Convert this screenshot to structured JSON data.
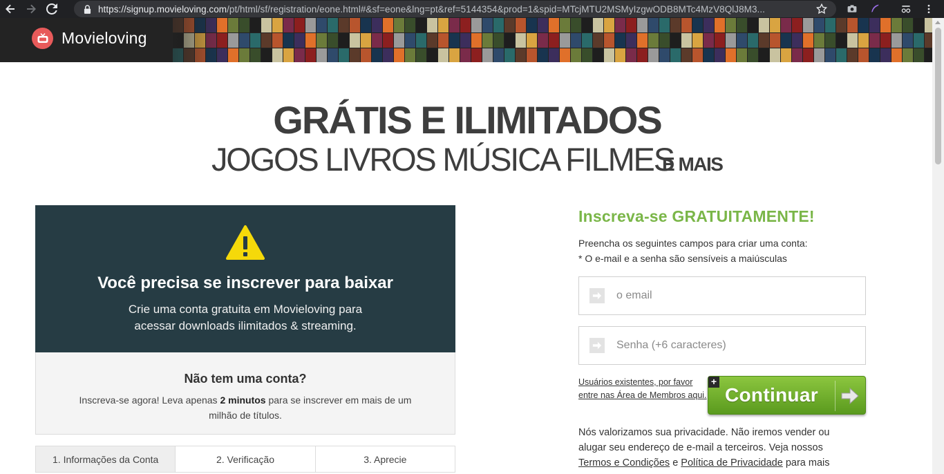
{
  "browser": {
    "url_host": "https://signup.movieloving.com",
    "url_rest": "/pt/html/sf/registration/eone.html#&sf=eone&lng=pt&ref=5144354&prod=1&spid=MTcjMTU2MSMyIzgwODB8MTc4MzV8QlJ8M3...",
    "icons": [
      "back-arrow",
      "forward-arrow",
      "reload",
      "lock",
      "star",
      "camera",
      "feather",
      "extensions",
      "menu"
    ]
  },
  "header": {
    "brand": "Movieloving",
    "poster_colors": [
      "#5b3a2a",
      "#2f4a6b",
      "#8c1f1f",
      "#d9a441",
      "#1e1e1e",
      "#6b7b3a",
      "#3c2e5c",
      "#b8552d",
      "#2a6a6a",
      "#9a9a9a",
      "#7a2b4a",
      "#c9c3a0",
      "#394d2b",
      "#e0702a",
      "#18344f"
    ]
  },
  "hero": {
    "title": "GRÁTIS E ILIMITADOS",
    "subtitle": "JOGOS LIVROS MÚSICA FILMES",
    "extra": "E MAIS"
  },
  "notice": {
    "heading": "Você precisa se inscrever para baixar",
    "text_line1": "Crie uma conta gratuita em Movieloving para",
    "text_line2": "acessar downloads ilimitados & streaming.",
    "icon": "warning-icon",
    "bg_color": "#263c44",
    "icon_color": "#f5d90a"
  },
  "no_account": {
    "heading": "Não tem uma conta?",
    "text_before": "Inscreva-se agora! Leva apenas ",
    "text_bold": "2 minutos",
    "text_after": " para se inscrever em mais de um milhão de títulos."
  },
  "steps": [
    {
      "label": "1. Informações da Conta",
      "active": true
    },
    {
      "label": "2. Verificação",
      "active": false
    },
    {
      "label": "3. Aprecie",
      "active": false
    }
  ],
  "form": {
    "title": "Inscreva-se GRATUITAMENTE!",
    "desc_line1": "Preencha os seguintes campos para criar uma conta:",
    "desc_line2": "* O e-mail e a senha são sensíveis a maiúsculas",
    "email_placeholder": "o email",
    "password_placeholder": "Senha (+6 caracteres)",
    "members_line1": "Usuários existentes, por favor",
    "members_line2": "entre nas Área de Membros aqui.",
    "continue_label": "Continuar",
    "accent_color": "#7ab648"
  },
  "privacy": {
    "text1": "Nós valorizamos sua privacidade. Não iremos vender ou alugar seu endereço de e-mail a terceiros. Veja nossos ",
    "terms_link": "Termos e Condições",
    "and": " e ",
    "privacy_link": "Política de Privacidade",
    "text2": " para mais"
  }
}
